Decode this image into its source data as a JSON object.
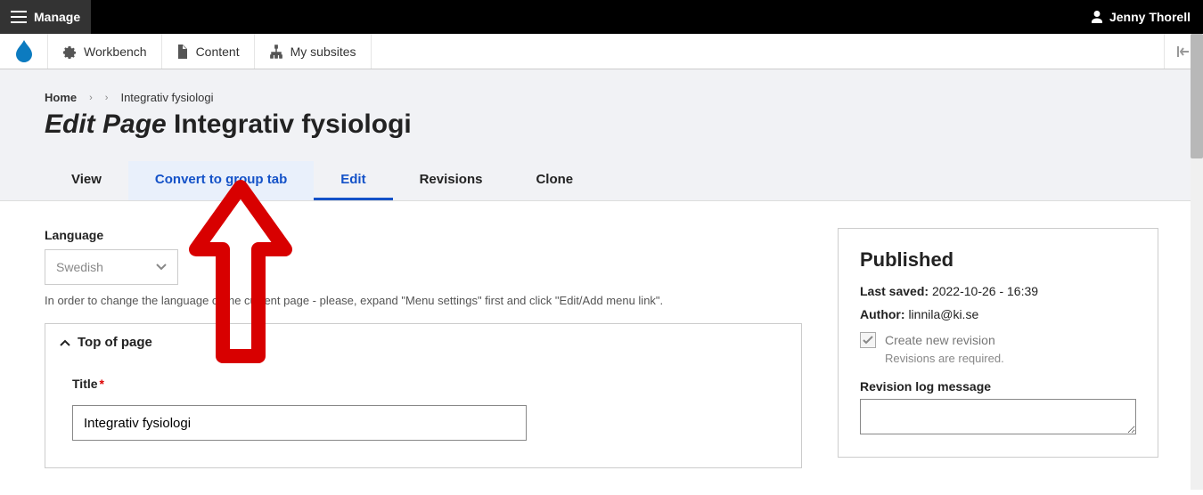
{
  "topbar": {
    "manage": "Manage",
    "username": "Jenny Thorell"
  },
  "toolbar": {
    "workbench": "Workbench",
    "content": "Content",
    "subsites": "My subsites"
  },
  "breadcrumb": {
    "home": "Home",
    "current": "Integrativ fysiologi"
  },
  "title": {
    "prefix": "Edit Page",
    "name": "Integrativ fysiologi"
  },
  "tabs": {
    "view": "View",
    "convert": "Convert to group tab",
    "edit": "Edit",
    "revisions": "Revisions",
    "clone": "Clone"
  },
  "form": {
    "language_label": "Language",
    "language_value": "Swedish",
    "language_help": "In order to change the language of the current page - please, expand \"Menu settings\" first and click \"Edit/Add menu link\".",
    "section_top": "Top of page",
    "title_label": "Title",
    "title_value": "Integrativ fysiologi"
  },
  "sidebar": {
    "status": "Published",
    "saved_label": "Last saved:",
    "saved_value": "2022-10-26 - 16:39",
    "author_label": "Author:",
    "author_value": "linnila@ki.se",
    "revision_chk": "Create new revision",
    "revision_note": "Revisions are required.",
    "revlog_label": "Revision log message"
  }
}
